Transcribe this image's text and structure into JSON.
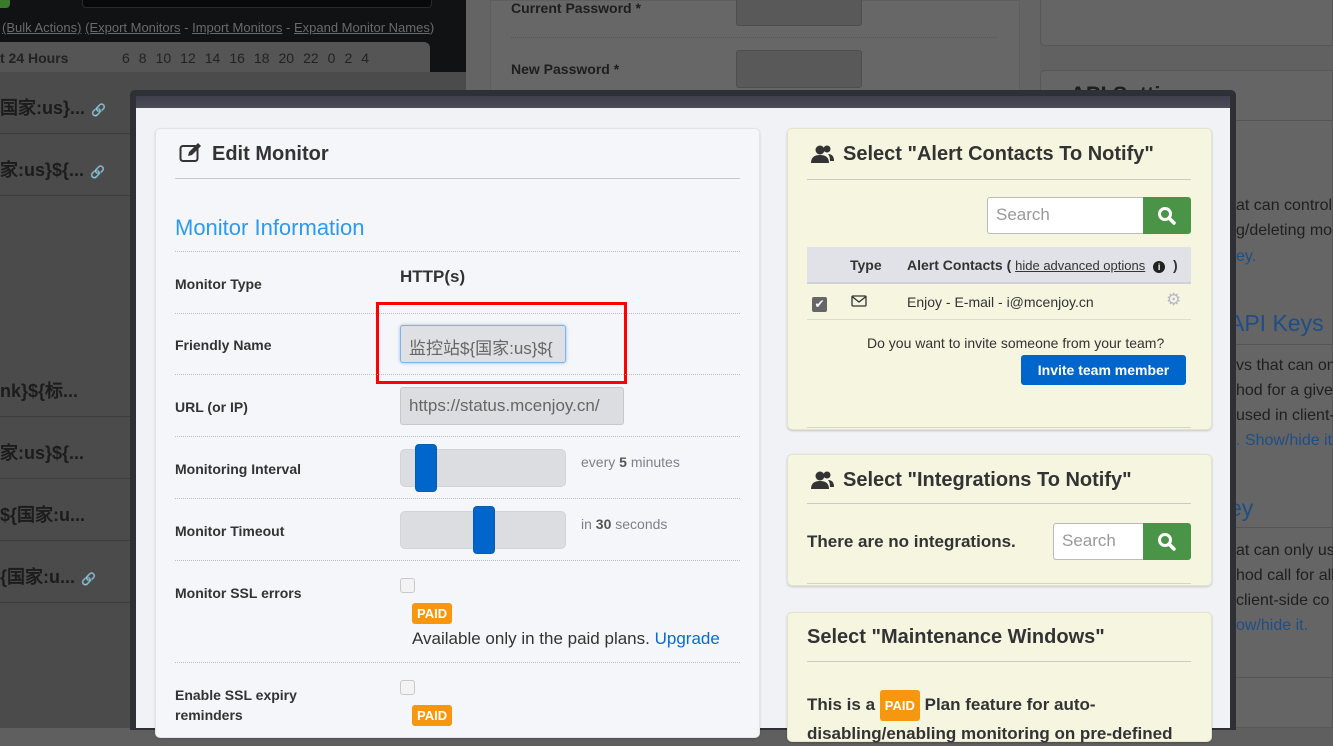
{
  "background": {
    "links": {
      "bulk": "(Bulk Actions)",
      "export": "(Export Monitors",
      "import": "Import Monitors",
      "expand": "Expand Monitor Names",
      "sep": "-",
      "close": ")"
    },
    "hours_label": "t 24 Hours",
    "hour_ticks": [
      "6",
      "8",
      "10",
      "12",
      "14",
      "16",
      "18",
      "20",
      "22",
      "0",
      "2",
      "4"
    ],
    "monitor_rows": [
      "国家:us}...",
      "家:us}${...",
      "nk}${标...",
      "家:us}${...",
      "${国家:u...",
      "{国家:u..."
    ],
    "current_password": "Current Password *",
    "new_password": "New Password *",
    "api_settings": "API Settings",
    "right_texts": [
      "at can control",
      "g/deleting mo",
      "ey.",
      "API Keys",
      "vs that can on",
      "hod for a giver",
      "used in client-",
      ". Show/hide it",
      "ey",
      "at can only us",
      "hod call for all",
      "client-side co",
      "ow/hide it."
    ]
  },
  "edit_monitor": {
    "title": "Edit Monitor",
    "section": "Monitor Information",
    "monitor_type_label": "Monitor Type",
    "monitor_type_value": "HTTP(s)",
    "friendly_name_label": "Friendly Name",
    "friendly_name_value": "监控站${国家:us}${",
    "url_label": "URL (or IP)",
    "url_value": "https://status.mcenjoy.cn/",
    "interval_label": "Monitoring Interval",
    "interval_hint_pre": "every",
    "interval_value": "5",
    "interval_hint_post": "minutes",
    "interval_slider_fraction": 0.1,
    "timeout_label": "Monitor Timeout",
    "timeout_hint_pre": "in",
    "timeout_value": "30",
    "timeout_hint_post": "seconds",
    "timeout_slider_fraction": 0.5,
    "ssl_errors_label": "Monitor SSL errors",
    "paid_badge": "PAID",
    "paid_text": "Available only in the paid plans.",
    "upgrade_link": "Upgrade",
    "ssl_expiry_label_1": "Enable SSL expiry",
    "ssl_expiry_label_2": "reminders"
  },
  "alert_contacts": {
    "title": "Select \"Alert Contacts To Notify\"",
    "search_placeholder": "Search",
    "col_type": "Type",
    "col_contacts": "Alert Contacts (",
    "hide_advanced": "hide advanced options",
    "col_close": ")",
    "rows": [
      {
        "checked": true,
        "type_icon": "envelope-icon",
        "contact": "Enjoy - E-mail - i@mcenjoy.cn"
      }
    ],
    "invite_prompt": "Do you want to invite someone from your team?",
    "invite_button": "Invite team member"
  },
  "integrations": {
    "title": "Select \"Integrations To Notify\"",
    "empty": "There are no integrations.",
    "search_placeholder": "Search"
  },
  "maintenance": {
    "title": "Select \"Maintenance Windows\"",
    "text_pre": "This is a",
    "paid_badge": "PAID",
    "text_post": "Plan feature for auto-",
    "text_line2": "disabling/enabling monitoring on pre-defined"
  },
  "colors": {
    "primary": "#0066cc",
    "search_green": "#4a9448",
    "paid_orange": "#f7960f",
    "link": "#0a6ad4",
    "section_blue": "#2b9af3",
    "highlight_red": "#ff0000"
  }
}
